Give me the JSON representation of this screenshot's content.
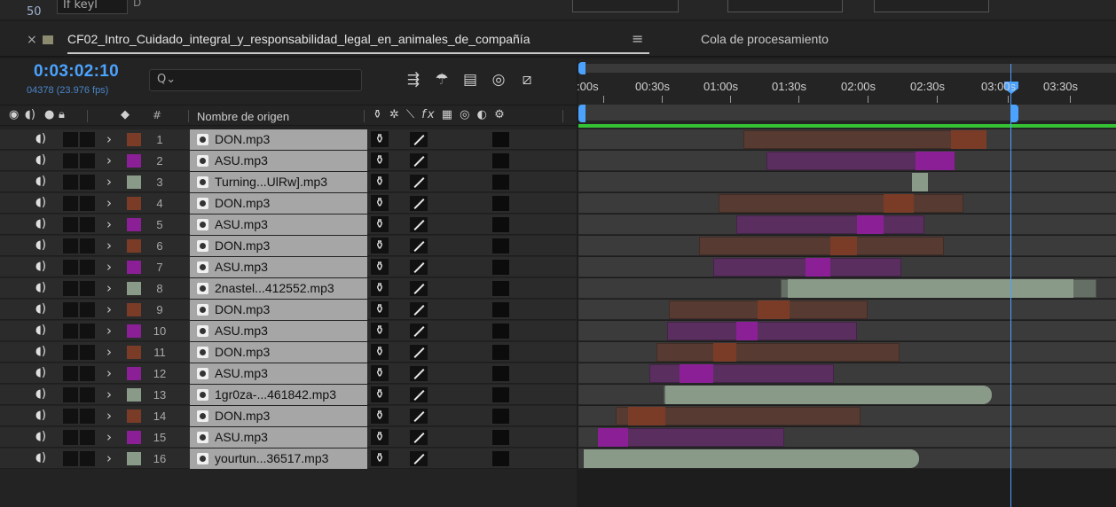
{
  "top_strip": {
    "number": "50",
    "keyframe_label": "If keyl",
    "letter": "D"
  },
  "tab": {
    "close": "×",
    "title": "CF02_Intro_Cuidado_integral_y_responsabilidad_legal_en_animales_de_compañía",
    "menu_icon": "≡",
    "render_queue": "Cola de procesamiento"
  },
  "time": {
    "timecode": "0:03:02:10",
    "frames": "04378 (23.976 fps)"
  },
  "search": {
    "icon": "Q⌄",
    "placeholder": ""
  },
  "columns": {
    "hash": "#",
    "source_name": "Nombre de origen"
  },
  "ruler": {
    "labels": [
      ":00s",
      "00:30s",
      "01:00s",
      "01:30s",
      "02:00s",
      "02:30s",
      "03:00s",
      "03:30s"
    ]
  },
  "colors": {
    "brown": "#7a3c27",
    "purple": "#8a1f96",
    "seafoam": "#8a9a88",
    "accent": "#4ba3ff",
    "work_area": "#35c335"
  },
  "layers": [
    {
      "index": "1",
      "name": "DON.mp3",
      "color": "brown"
    },
    {
      "index": "2",
      "name": "ASU.mp3",
      "color": "purple"
    },
    {
      "index": "3",
      "name": "Turning...UlRw].mp3",
      "color": "seafoam"
    },
    {
      "index": "4",
      "name": "DON.mp3",
      "color": "brown"
    },
    {
      "index": "5",
      "name": "ASU.mp3",
      "color": "purple"
    },
    {
      "index": "6",
      "name": "DON.mp3",
      "color": "brown"
    },
    {
      "index": "7",
      "name": "ASU.mp3",
      "color": "purple"
    },
    {
      "index": "8",
      "name": "2nastel...412552.mp3",
      "color": "seafoam"
    },
    {
      "index": "9",
      "name": "DON.mp3",
      "color": "brown"
    },
    {
      "index": "10",
      "name": "ASU.mp3",
      "color": "purple"
    },
    {
      "index": "11",
      "name": "DON.mp3",
      "color": "brown"
    },
    {
      "index": "12",
      "name": "ASU.mp3",
      "color": "purple"
    },
    {
      "index": "13",
      "name": "1gr0za-...461842.mp3",
      "color": "seafoam"
    },
    {
      "index": "14",
      "name": "DON.mp3",
      "color": "brown"
    },
    {
      "index": "15",
      "name": "ASU.mp3",
      "color": "purple"
    },
    {
      "index": "16",
      "name": "yourtun...36517.mp3",
      "color": "seafoam"
    }
  ]
}
